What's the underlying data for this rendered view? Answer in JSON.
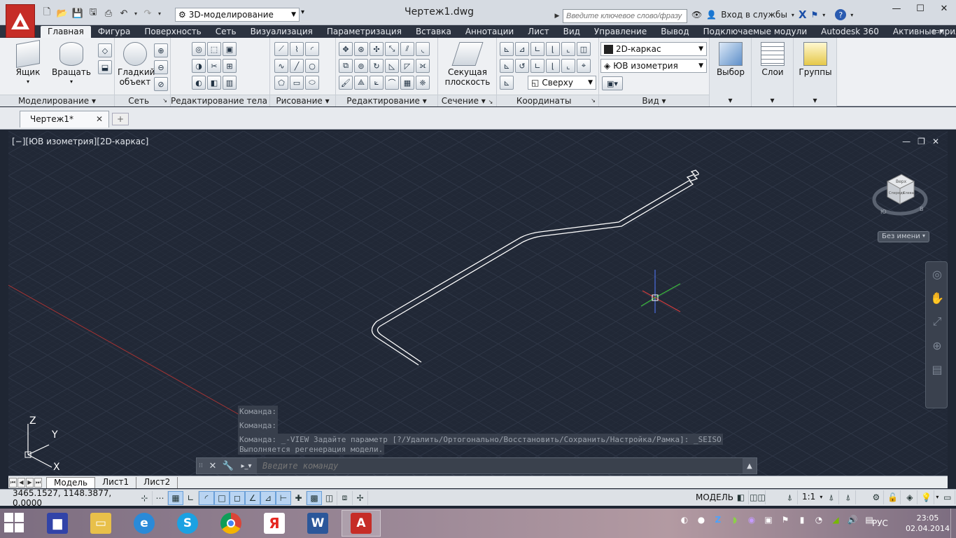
{
  "title_bar": {
    "workspace": "3D-моделирование",
    "document_title": "Чертеж1.dwg",
    "search_placeholder": "Введите ключевое слово/фразу",
    "signin_label": "Вход в службы",
    "help_label": "?"
  },
  "ribbon": {
    "tabs": [
      "Главная",
      "Фигура",
      "Поверхность",
      "Сеть",
      "Визуализация",
      "Параметризация",
      "Вставка",
      "Аннотации",
      "Лист",
      "Вид",
      "Управление",
      "Вывод",
      "Подключаемые модули",
      "Autodesk 360",
      "Активные приложения"
    ],
    "active_tab": "Главная",
    "panels": {
      "modeling": {
        "title": "Моделирование",
        "box_label": "Ящик",
        "revolve_label": "Вращать"
      },
      "mesh": {
        "title": "Сеть",
        "smooth_label_1": "Гладкий",
        "smooth_label_2": "объект"
      },
      "solid_edit": {
        "title": "Редактирование тела"
      },
      "draw": {
        "title": "Рисование"
      },
      "modify": {
        "title": "Редактирование"
      },
      "section": {
        "title": "Сечение",
        "plane_label_1": "Секущая",
        "plane_label_2": "плоскость"
      },
      "coordinates": {
        "title": "Координаты",
        "view_combo": "Сверху"
      },
      "view": {
        "title": "Вид",
        "visual_style": "2D-каркас",
        "view_direction": "ЮВ изометрия"
      },
      "selection": {
        "label": "Выбор"
      },
      "layers": {
        "label": "Слои"
      },
      "groups": {
        "label": "Группы"
      }
    }
  },
  "file_tabs": {
    "active": "Чертеж1*"
  },
  "viewport": {
    "label": "[−][ЮВ изометрия][2D-каркас]",
    "view_name": "Без имени",
    "viewcube_faces": {
      "top": "Верх",
      "front": "Спереди",
      "left": "Слева"
    },
    "compass": {
      "south": "Ю",
      "east": "В"
    },
    "ucs": {
      "x": "X",
      "y": "Y",
      "z": "Z"
    }
  },
  "command_line": {
    "history": [
      "Команда:",
      "Команда:",
      "Команда: _-VIEW Задайте параметр [?/Удалить/Ортогонально/Восстановить/Сохранить/Настройка/Рамка]: _SEISO",
      "Выполняется регенерация модели."
    ],
    "placeholder": "Введите команду"
  },
  "layout_tabs": [
    "Модель",
    "Лист1",
    "Лист2"
  ],
  "status_bar": {
    "coordinates": "3465.1527, 1148.3877, 0.0000",
    "model_label": "МОДЕЛЬ",
    "scale": "1:1"
  },
  "taskbar": {
    "language": "РУС",
    "time": "23:05",
    "date": "02.04.2014",
    "apps": [
      "Сохранение",
      "Проводник",
      "Internet Explorer",
      "Skype",
      "Google Chrome",
      "Яндекс",
      "Word",
      "AutoCAD"
    ],
    "active_app": "AutoCAD"
  },
  "colors": {
    "canvas_bg": "#212836",
    "autocad_red": "#c62d27",
    "ribbon_tab_bar": "#2c3340",
    "x_axis": "#d33b3b",
    "y_axis": "#3bbf3b",
    "z_axis": "#4b6de0"
  },
  "icons": {
    "titlebar": [
      "new-icon",
      "open-icon",
      "save-icon",
      "saveas-icon",
      "print-icon",
      "undo-icon",
      "redo-icon"
    ],
    "navbar": [
      "steering-wheel-icon",
      "pan-icon",
      "zoom-icon",
      "orbit-icon",
      "showmotion-icon"
    ]
  }
}
